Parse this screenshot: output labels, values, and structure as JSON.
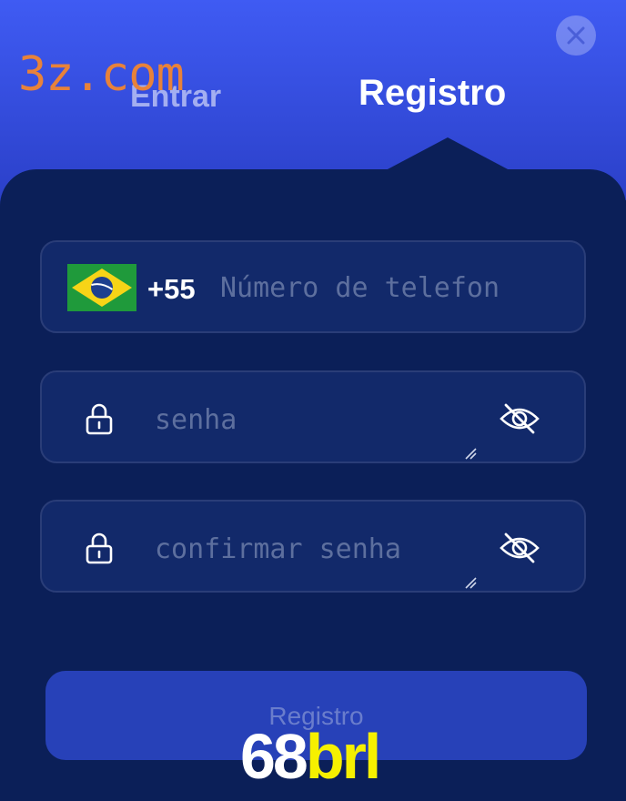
{
  "watermark": {
    "top_text": "3z.com",
    "bottom_num": "68",
    "bottom_text": "brl"
  },
  "header": {
    "tabs": [
      {
        "label": "Entrar",
        "active": false
      },
      {
        "label": "Registro",
        "active": true
      }
    ],
    "close_icon": "close-icon"
  },
  "form": {
    "phone": {
      "flag_icon": "brazil-flag-icon",
      "country_code": "+55",
      "value": "",
      "placeholder": "Número de telefon"
    },
    "password": {
      "lock_icon": "lock-icon",
      "value": "",
      "placeholder": "senha",
      "visibility_icon": "eye-off-icon"
    },
    "confirm_password": {
      "lock_icon": "lock-icon",
      "value": "",
      "placeholder": "confirmar senha",
      "visibility_icon": "eye-off-icon"
    },
    "submit_label": "Registro"
  },
  "colors": {
    "header_blue": "#3f5bf3",
    "panel_navy": "#0b1f58",
    "field_bg": "#12296a",
    "button_bg": "#2741b8",
    "watermark_orange": "#e8823a",
    "logo_yellow": "#f6f000"
  }
}
